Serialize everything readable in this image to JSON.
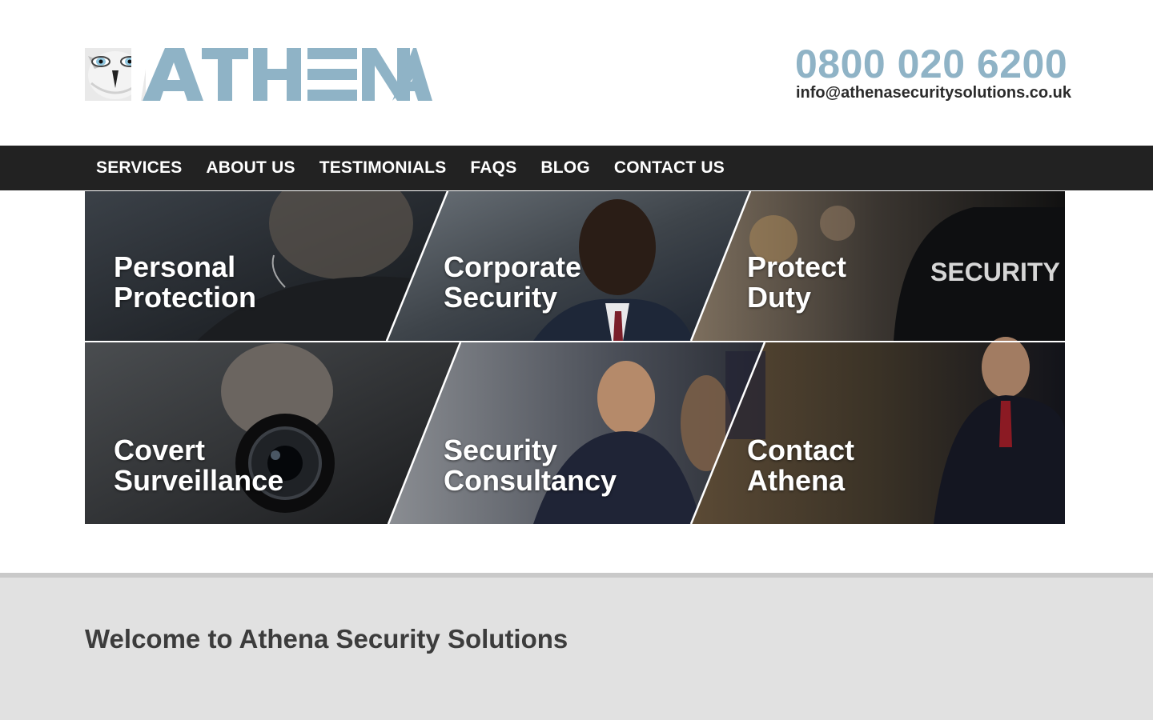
{
  "brand": {
    "logo_text": "ATHENA",
    "accent_color": "#8fb3c6"
  },
  "contact": {
    "phone": "0800 020 6200",
    "email": "info@athenasecuritysolutions.co.uk"
  },
  "nav": {
    "items": [
      {
        "label": "SERVICES"
      },
      {
        "label": "ABOUT US"
      },
      {
        "label": "TESTIMONIALS"
      },
      {
        "label": "FAQS"
      },
      {
        "label": "BLOG"
      },
      {
        "label": "CONTACT US"
      }
    ]
  },
  "tiles": [
    {
      "line1": "Personal",
      "line2": "Protection",
      "image": "bodyguard-earpiece-photo"
    },
    {
      "line1": "Corporate",
      "line2": "Security",
      "image": "businessman-suit-photo"
    },
    {
      "line1": "Protect",
      "line2": "Duty",
      "image": "security-guard-back-photo"
    },
    {
      "line1": "Covert",
      "line2": "Surveillance",
      "image": "man-with-camera-in-car-photo"
    },
    {
      "line1": "Security",
      "line2": "Consultancy",
      "image": "consultant-meeting-photo"
    },
    {
      "line1": "Contact",
      "line2": "Athena",
      "image": "guard-in-ornate-room-photo"
    }
  ],
  "tile_photo_text": "SECURITY",
  "welcome": {
    "heading": "Welcome to Athena Security Solutions"
  }
}
